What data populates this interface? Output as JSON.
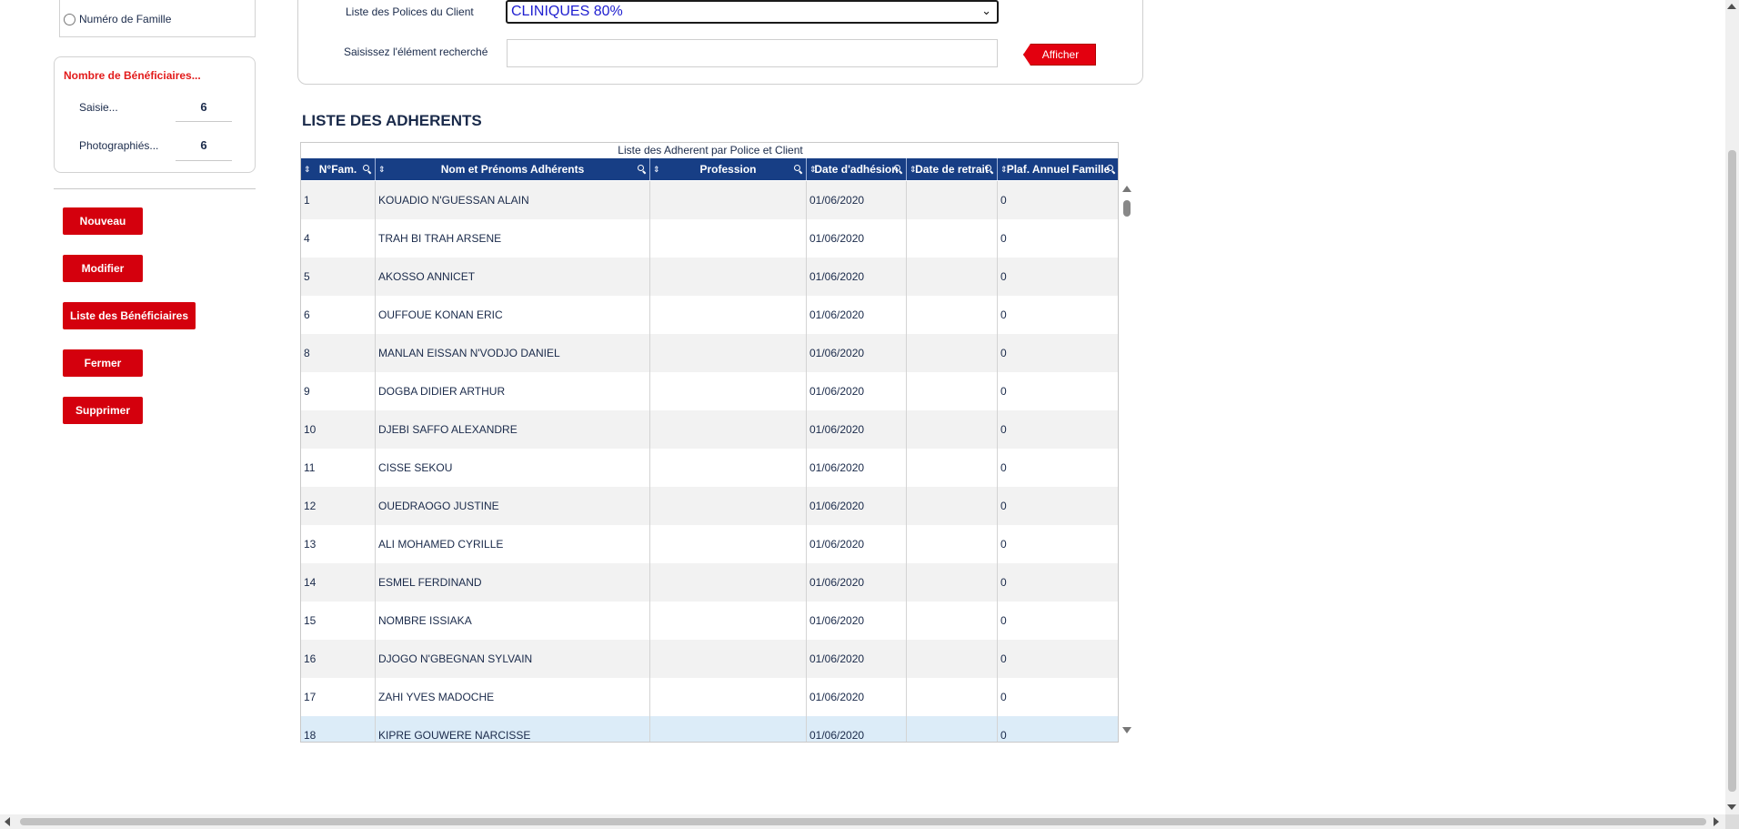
{
  "search_type": {
    "radio_label": "Numéro de Famille"
  },
  "beneficiaires": {
    "title": "Nombre de Bénéficiaires...",
    "saisie_label": "Saisie...",
    "saisie_value": "6",
    "photo_label": "Photographiés...",
    "photo_value": "6"
  },
  "actions": {
    "nouveau": "Nouveau",
    "modifier": "Modifier",
    "liste_beneficiaires": "Liste des Bénéficiaires",
    "fermer": "Fermer",
    "supprimer": "Supprimer"
  },
  "form": {
    "policy_label": "Liste des Polices du Client",
    "policy_selected": "CLINIQUES 80%",
    "search_label": "Saisissez l'élément recherché",
    "search_value": "",
    "afficher": "Afficher"
  },
  "grid": {
    "section_title": "LISTE DES ADHERENTS",
    "caption": "Liste des Adherent par Police et Client",
    "columns": [
      "N°Fam.",
      "Nom et Prénoms Adhérents",
      "Profession",
      "Date d'adhésion",
      "Date de retrait",
      "Plaf. Annuel Famille"
    ],
    "rows": [
      [
        "1",
        "KOUADIO N'GUESSAN ALAIN",
        "",
        "01/06/2020",
        "",
        "0"
      ],
      [
        "4",
        "TRAH BI TRAH ARSENE",
        "",
        "01/06/2020",
        "",
        "0"
      ],
      [
        "5",
        "AKOSSO ANNICET",
        "",
        "01/06/2020",
        "",
        "0"
      ],
      [
        "6",
        "OUFFOUE KONAN ERIC",
        "",
        "01/06/2020",
        "",
        "0"
      ],
      [
        "8",
        "MANLAN EISSAN N'VODJO DANIEL",
        "",
        "01/06/2020",
        "",
        "0"
      ],
      [
        "9",
        "DOGBA DIDIER ARTHUR",
        "",
        "01/06/2020",
        "",
        "0"
      ],
      [
        "10",
        "DJEBI SAFFO ALEXANDRE",
        "",
        "01/06/2020",
        "",
        "0"
      ],
      [
        "11",
        "CISSE SEKOU",
        "",
        "01/06/2020",
        "",
        "0"
      ],
      [
        "12",
        "OUEDRAOGO JUSTINE",
        "",
        "01/06/2020",
        "",
        "0"
      ],
      [
        "13",
        "ALI MOHAMED CYRILLE",
        "",
        "01/06/2020",
        "",
        "0"
      ],
      [
        "14",
        "ESMEL FERDINAND",
        "",
        "01/06/2020",
        "",
        "0"
      ],
      [
        "15",
        "NOMBRE ISSIAKA",
        "",
        "01/06/2020",
        "",
        "0"
      ],
      [
        "16",
        "DJOGO N'GBEGNAN SYLVAIN",
        "",
        "01/06/2020",
        "",
        "0"
      ],
      [
        "17",
        "ZAHI YVES MADOCHE",
        "",
        "01/06/2020",
        "",
        "0"
      ],
      [
        "18",
        "KIPRE GOUWERE NARCISSE",
        "",
        "01/06/2020",
        "",
        "0"
      ]
    ]
  },
  "colors": {
    "accent_red": "#d4000d",
    "header_blue": "#173e85",
    "text_navy": "#1a2a4a"
  }
}
